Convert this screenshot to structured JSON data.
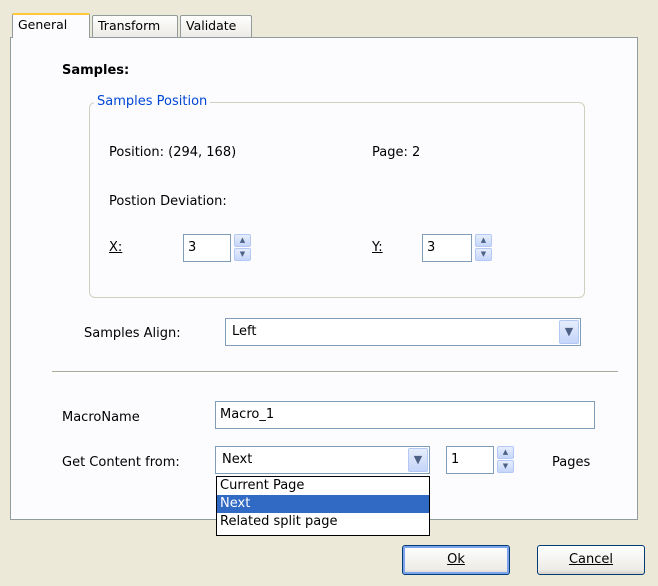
{
  "tabs": [
    {
      "label": "General",
      "key": "G"
    },
    {
      "label": "Transform",
      "key": "T"
    },
    {
      "label": "Validate",
      "key": "V"
    }
  ],
  "samples_heading": "Samples:",
  "position_group": {
    "legend": "Samples Position",
    "position_text": "Position: (294, 168)",
    "page_text": "Page: 2",
    "deviation_label": "Postion Deviation:",
    "x_label": "X:",
    "x_value": "3",
    "y_label": "Y:",
    "y_value": "3"
  },
  "align": {
    "label": "Samples Align:",
    "value": "Left"
  },
  "macro": {
    "label": "MacroName",
    "value": "Macro_1"
  },
  "content": {
    "label": "Get Content from:",
    "selected": "Next",
    "options": [
      "Current Page",
      "Next",
      "Related split page"
    ],
    "pages_value": "1",
    "pages_label": "Pages"
  },
  "buttons": {
    "ok": "Ok",
    "cancel": "Cancel"
  },
  "colors": {
    "legend": "#0046d5",
    "selection": "#316ac5",
    "background": "#ece9d8"
  }
}
